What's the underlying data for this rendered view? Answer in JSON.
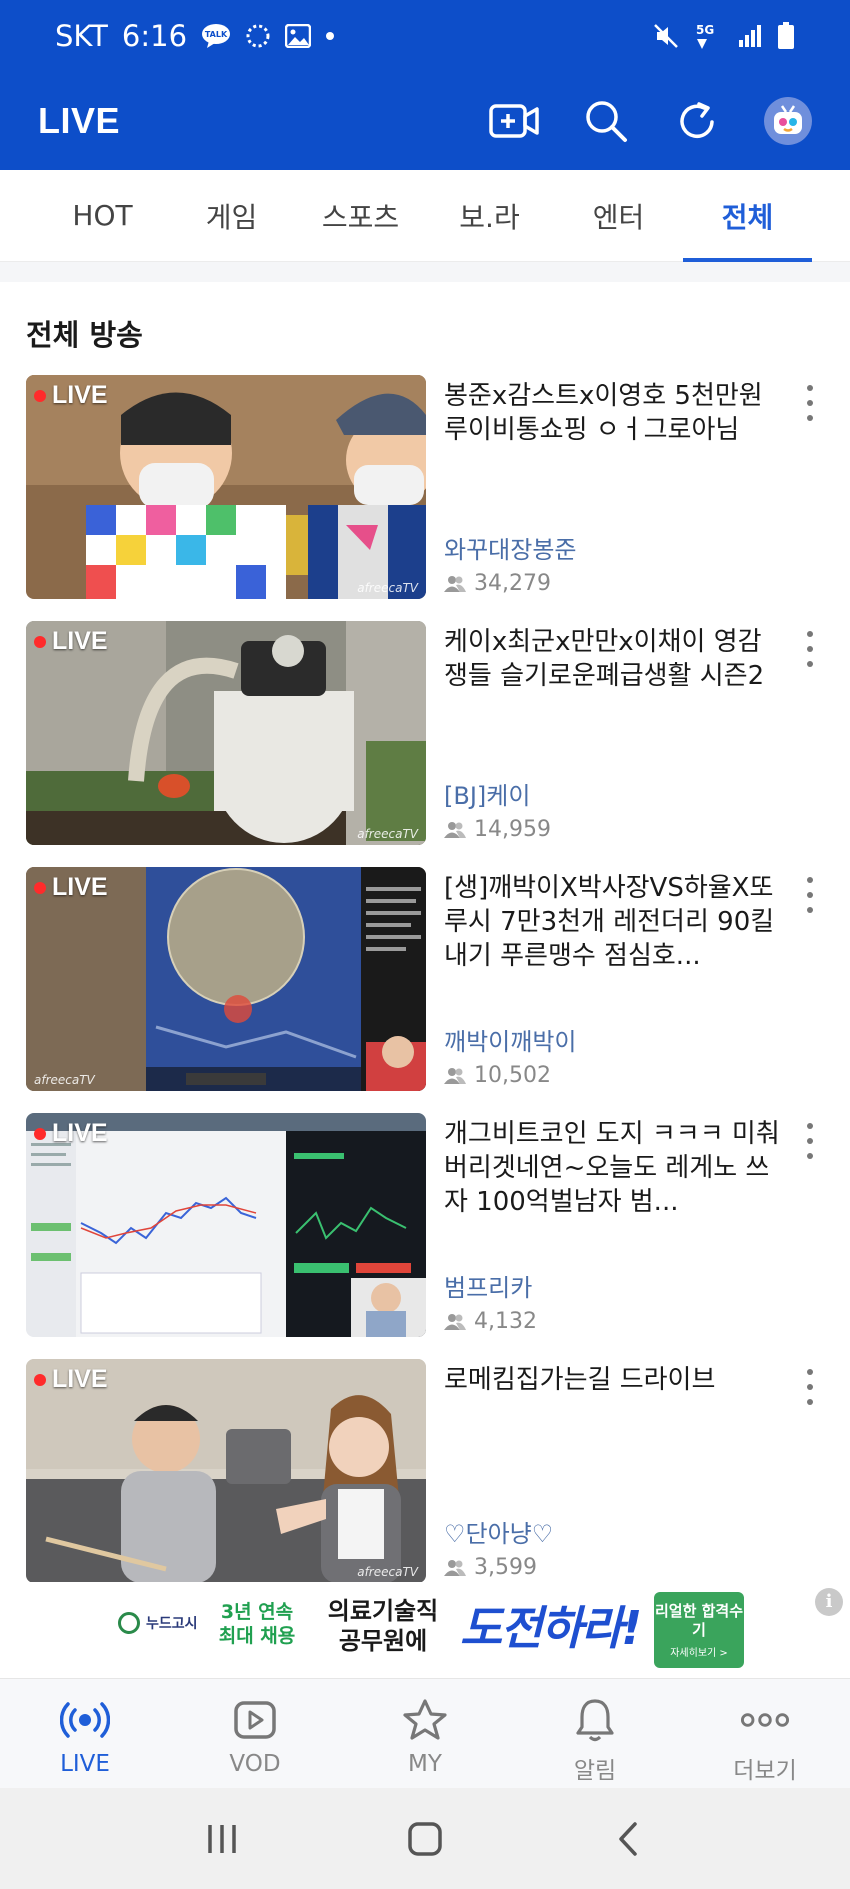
{
  "status_bar": {
    "carrier": "SKT",
    "time": "6:16",
    "talk_icon_text": "TALK",
    "network": "5G"
  },
  "header": {
    "title": "LIVE",
    "icons": [
      "video-add-icon",
      "search-icon",
      "refresh-icon",
      "avatar"
    ]
  },
  "tabs": [
    {
      "label": "HOT"
    },
    {
      "label": "게임"
    },
    {
      "label": "스포츠"
    },
    {
      "label": "보.라"
    },
    {
      "label": "엔터"
    },
    {
      "label": "전체"
    }
  ],
  "active_tab": "전체",
  "section_title": "전체 방송",
  "live_label": "LIVE",
  "watermark": "afreecaTV",
  "broadcasts": [
    {
      "title": "봉준x감스트x이영호 5천만원 루이비통쇼핑 ㅇㅓ그로아님",
      "channel": "와꾸대장봉준",
      "viewers": "34,279"
    },
    {
      "title": "케이x최군x만만x이채이 영감쟁들 슬기로운폐급생활 시즌2",
      "channel": "[BJ]케이",
      "viewers": "14,959"
    },
    {
      "title": "[생]깨박이X박사장VS하율X또루시 7만3천개 레전더리 90킬내기 푸른맹수 점심호...",
      "channel": "깨박이깨박이",
      "viewers": "10,502"
    },
    {
      "title": "개그비트코인 도지 ㅋㅋㅋ 미춰버리겟네연~오늘도 레게노 쓰자 100억벌남자 범...",
      "channel": "범프리카",
      "viewers": "4,132"
    },
    {
      "title": "로메킴집가는길 드라이브",
      "channel": "♡단아냥♡",
      "viewers": "3,599"
    }
  ],
  "ad": {
    "brand": "누드고시",
    "green_text": "3년 연속 최대 채용",
    "main_text": "의료기술직 공무원에",
    "blue_text": "도전하라!",
    "cta_text": "리얼한 합격수기",
    "cta_sub": "자세히보기 >",
    "info_icon": "i"
  },
  "bottom_nav": [
    {
      "label": "LIVE",
      "icon": "broadcast-icon",
      "active": true
    },
    {
      "label": "VOD",
      "icon": "play-icon",
      "active": false
    },
    {
      "label": "MY",
      "icon": "star-icon",
      "active": false
    },
    {
      "label": "알림",
      "icon": "bell-icon",
      "active": false
    },
    {
      "label": "더보기",
      "icon": "more-icon",
      "active": false
    }
  ],
  "colors": {
    "brand": "#0d4ec9",
    "accent": "#1f5ed8",
    "channel": "#4a6ea8",
    "live_dot": "#ff2b2b"
  }
}
